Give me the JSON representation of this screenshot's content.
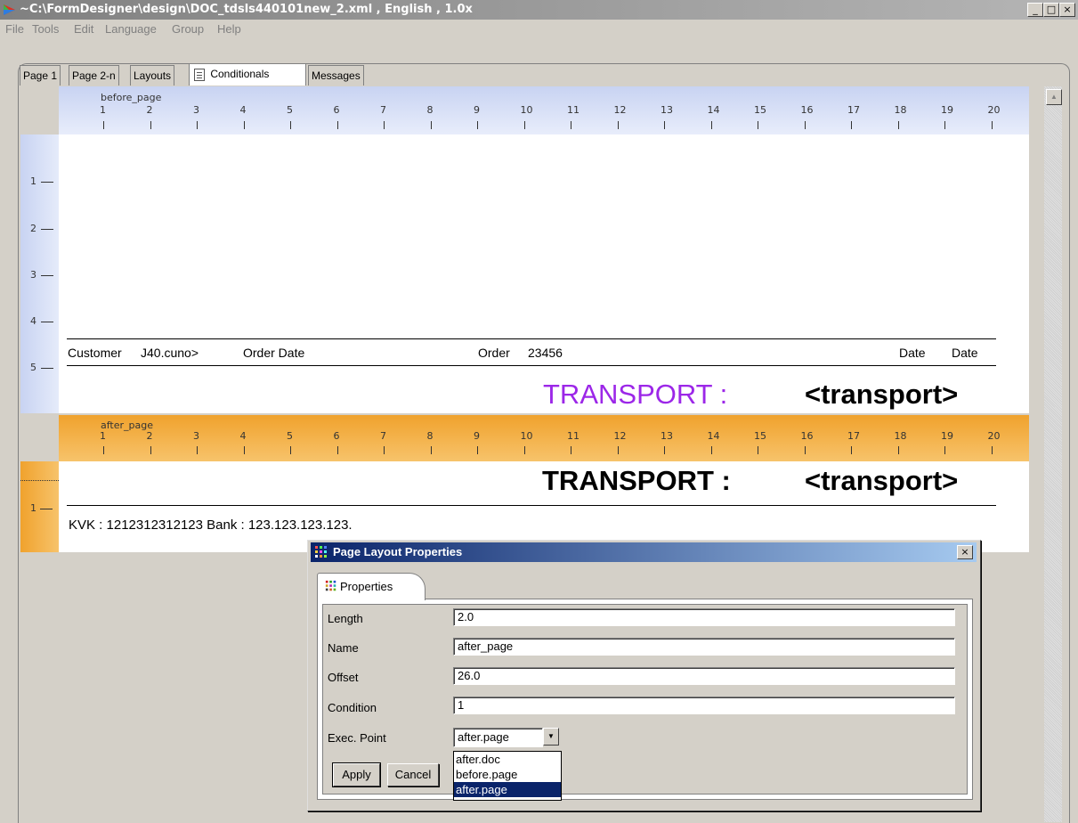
{
  "window": {
    "title": "~C:\\FormDesigner\\design\\DOC_tdsls440101new_2.xml , English , 1.0x",
    "minimize": "_",
    "maximize": "□",
    "close": "×"
  },
  "menu": [
    "File",
    "Tools",
    "Edit",
    "Language",
    "Group",
    "Help"
  ],
  "tabs": [
    {
      "label": "Page 1"
    },
    {
      "label": "Page 2-n"
    },
    {
      "label": "Layouts"
    },
    {
      "label": "Conditionals",
      "active": true,
      "icon": "document-icon"
    },
    {
      "label": "Messages"
    }
  ],
  "ruler_ticks": [
    "1",
    "2",
    "3",
    "4",
    "5",
    "6",
    "7",
    "8",
    "9",
    "10",
    "11",
    "12",
    "13",
    "14",
    "15",
    "16",
    "17",
    "18",
    "19",
    "20"
  ],
  "layout1": {
    "name": "before_page",
    "row_numbers": [
      "1",
      "2",
      "3",
      "4",
      "5"
    ],
    "fields": {
      "customer": "Customer",
      "cuno": "J40.cuno>",
      "order_date": "Order Date",
      "order": "Order",
      "order_no": "23456",
      "date1": "Date",
      "date2": "Date"
    },
    "transport_label": "TRANSPORT :",
    "transport_value": "<transport>"
  },
  "layout2": {
    "name": "after_page",
    "row_numbers": [
      "1"
    ],
    "transport_label": "TRANSPORT :",
    "transport_value": "<transport>",
    "footer": "KVK : 1212312312123   Bank : 123.123.123.123."
  },
  "dialog": {
    "title": "Page Layout Properties",
    "close": "×",
    "tab": "Properties",
    "fields": [
      {
        "label": "Length",
        "value": "2.0"
      },
      {
        "label": "Name",
        "value": "after_page"
      },
      {
        "label": "Offset",
        "value": "26.0"
      },
      {
        "label": "Condition",
        "value": "1"
      }
    ],
    "exec_point": {
      "label": "Exec. Point",
      "value": "after.page",
      "options": [
        "after.doc",
        "before.page",
        "after.page"
      ],
      "selected": "after.page"
    },
    "apply": "Apply",
    "cancel": "Cancel"
  },
  "colors": {
    "transport_label_color": "#9c27e8",
    "ruler_blue": "#c8d3f2",
    "ruler_orange": "#f0a22d",
    "selection": "#0a246a"
  }
}
